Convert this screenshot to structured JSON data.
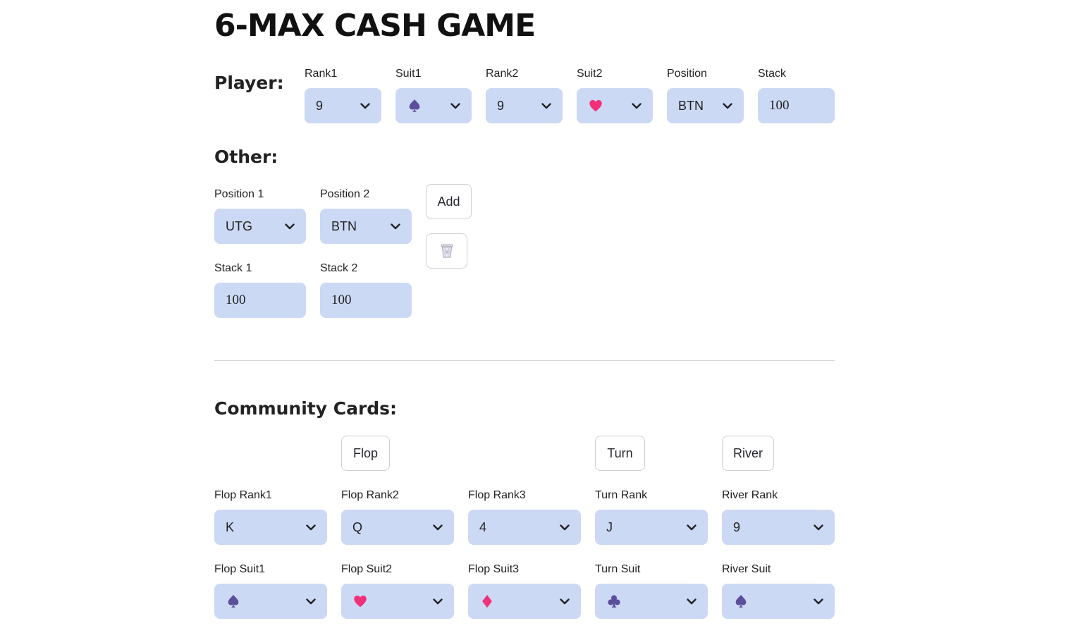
{
  "title": "6-MAX CASH GAME",
  "player": {
    "heading": "Player:",
    "rank1": {
      "label": "Rank1",
      "value": "9"
    },
    "suit1": {
      "label": "Suit1",
      "icon": "spade-icon",
      "color": "#5b4f9a"
    },
    "rank2": {
      "label": "Rank2",
      "value": "9"
    },
    "suit2": {
      "label": "Suit2",
      "icon": "heart-icon",
      "color": "#f0317a"
    },
    "position": {
      "label": "Position",
      "value": "BTN"
    },
    "stack": {
      "label": "Stack",
      "value": "100"
    }
  },
  "other": {
    "heading": "Other:",
    "position1": {
      "label": "Position 1",
      "value": "UTG"
    },
    "position2": {
      "label": "Position 2",
      "value": "BTN"
    },
    "stack1": {
      "label": "Stack 1",
      "value": "100"
    },
    "stack2": {
      "label": "Stack 2",
      "value": "100"
    },
    "add_label": "Add",
    "delete_icon": "trash-icon"
  },
  "community": {
    "heading": "Community Cards:",
    "flop_button": "Flop",
    "turn_button": "Turn",
    "river_button": "River",
    "flop_rank1": {
      "label": "Flop Rank1",
      "value": "K"
    },
    "flop_rank2": {
      "label": "Flop Rank2",
      "value": "Q"
    },
    "flop_rank3": {
      "label": "Flop Rank3",
      "value": "4"
    },
    "turn_rank": {
      "label": "Turn Rank",
      "value": "J"
    },
    "river_rank": {
      "label": "River Rank",
      "value": "9"
    },
    "flop_suit1": {
      "label": "Flop Suit1",
      "icon": "spade-icon",
      "color": "#5b4f9a"
    },
    "flop_suit2": {
      "label": "Flop Suit2",
      "icon": "heart-icon",
      "color": "#f0317a"
    },
    "flop_suit3": {
      "label": "Flop Suit3",
      "icon": "diamond-icon",
      "color": "#f0317a"
    },
    "turn_suit": {
      "label": "Turn Suit",
      "icon": "club-icon",
      "color": "#5b4f9a"
    },
    "river_suit": {
      "label": "River Suit",
      "icon": "spade-icon",
      "color": "#5b4f9a"
    }
  },
  "colors": {
    "input_bg": "#ccd9f4",
    "spade_club": "#5b4f9a",
    "heart_diamond": "#f0317a"
  }
}
